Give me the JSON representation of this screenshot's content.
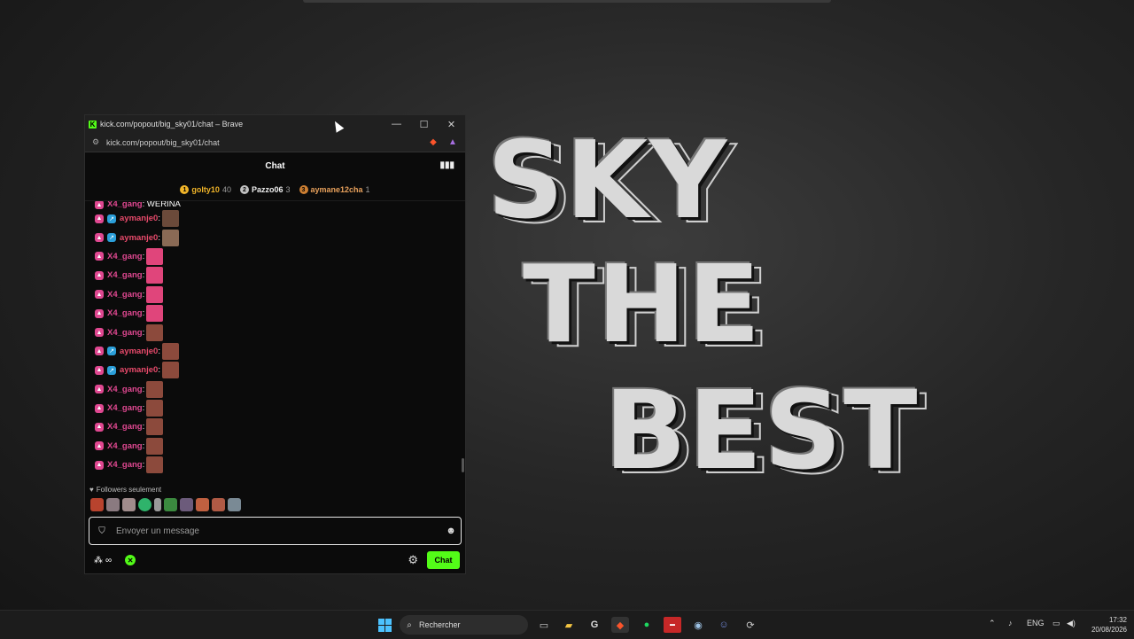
{
  "wallpaper": {
    "line1": "SKY",
    "line2": "THE",
    "line3": "BEST"
  },
  "window": {
    "title": "kick.com/popout/big_sky01/chat – Brave",
    "url": "kick.com/popout/big_sky01/chat",
    "controls": {
      "minimize": "—",
      "maximize": "☐",
      "close": "✕"
    }
  },
  "chat": {
    "header": "Chat",
    "leaderboard": [
      {
        "rank": "1",
        "name": "golty10",
        "count": "40",
        "color": "#f0b429"
      },
      {
        "rank": "2",
        "name": "Pazzo06",
        "count": "3",
        "color": "#c0c0c0"
      },
      {
        "rank": "3",
        "name": "aymane12cha",
        "count": "1",
        "color": "#cd7f32"
      }
    ],
    "partial_message": {
      "user": "X4_gang",
      "text": ": WERINA"
    },
    "messages": [
      {
        "user": "aymanje0",
        "sep": ":",
        "emote": "#6b4a3a",
        "blue_badge": true,
        "name_color": "#e84a6b"
      },
      {
        "user": "aymanje0",
        "sep": ":",
        "emote": "#8a6a55",
        "blue_badge": true,
        "name_color": "#e84a6b"
      },
      {
        "user": "X4_gang",
        "sep": ":",
        "emote": "#e0457b",
        "blue_badge": false,
        "name_color": "#e04891"
      },
      {
        "user": "X4_gang",
        "sep": ":",
        "emote": "#e0457b",
        "blue_badge": false,
        "name_color": "#e04891"
      },
      {
        "user": "X4_gang",
        "sep": ":",
        "emote": "#e0457b",
        "blue_badge": false,
        "name_color": "#e04891"
      },
      {
        "user": "X4_gang",
        "sep": ":",
        "emote": "#e0457b",
        "blue_badge": false,
        "name_color": "#e04891"
      },
      {
        "user": "X4_gang",
        "sep": ":",
        "emote": "#8c4a3c",
        "blue_badge": false,
        "name_color": "#e04891"
      },
      {
        "user": "aymanje0",
        "sep": ":",
        "emote": "#8c4a3c",
        "blue_badge": true,
        "name_color": "#e84a6b"
      },
      {
        "user": "aymanje0",
        "sep": ":",
        "emote": "#8c4a3c",
        "blue_badge": true,
        "name_color": "#e84a6b"
      },
      {
        "user": "X4_gang",
        "sep": ":",
        "emote": "#8c4a3c",
        "blue_badge": false,
        "name_color": "#e04891"
      },
      {
        "user": "X4_gang",
        "sep": ":",
        "emote": "#8c4a3c",
        "blue_badge": false,
        "name_color": "#e04891"
      },
      {
        "user": "X4_gang",
        "sep": ":",
        "emote": "#8c4a3c",
        "blue_badge": false,
        "name_color": "#e04891"
      },
      {
        "user": "X4_gang",
        "sep": ":",
        "emote": "#8c4a3c",
        "blue_badge": false,
        "name_color": "#e04891"
      },
      {
        "user": "X4_gang",
        "sep": ":",
        "emote": "#8c4a3c",
        "blue_badge": false,
        "name_color": "#e04891"
      }
    ],
    "followers_label": "Followers seulement",
    "input_placeholder": "Envoyer un message",
    "points_label": "∞",
    "send_label": "Chat"
  },
  "taskbar": {
    "search_label": "Rechercher",
    "language": "ENG",
    "time": "17:32",
    "date": "20/08/2026"
  },
  "colors": {
    "kick_green": "#53fc18",
    "pink_user": "#e04891",
    "accent_red": "#e84a6b"
  }
}
